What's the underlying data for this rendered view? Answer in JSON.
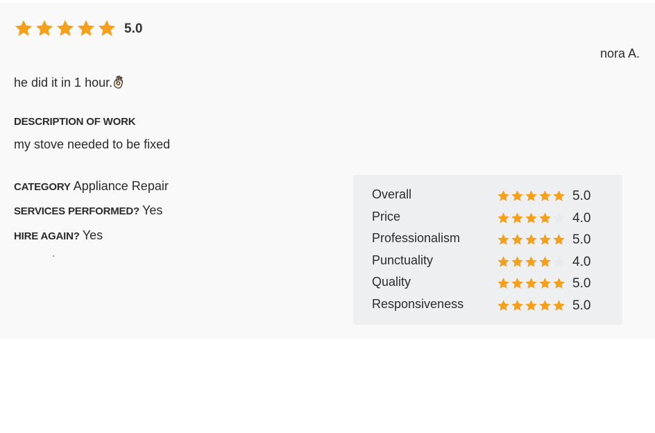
{
  "colors": {
    "star_filled": "#f5a01a",
    "star_empty": "#e8e9ec",
    "card_bg": "#f9f9fa",
    "ratings_bg": "#eeeff1"
  },
  "review": {
    "overall_stars": 5,
    "overall_score": "5.0",
    "reviewer": "nora A.",
    "text": "he did it in 1 hour.",
    "emoji_icon": "ok-hand-icon"
  },
  "description": {
    "label": "DESCRIPTION OF WORK",
    "text": "my stove needed to be fixed"
  },
  "details": [
    {
      "label": "CATEGORY",
      "value": "Appliance Repair"
    },
    {
      "label": "SERVICES PERFORMED?",
      "value": "Yes"
    },
    {
      "label": "HIRE AGAIN?",
      "value": "Yes"
    }
  ],
  "ratings": [
    {
      "label": "Overall",
      "stars": 5,
      "value": "5.0"
    },
    {
      "label": "Price",
      "stars": 4,
      "value": "4.0"
    },
    {
      "label": "Professionalism",
      "stars": 5,
      "value": "5.0"
    },
    {
      "label": "Punctuality",
      "stars": 4,
      "value": "4.0"
    },
    {
      "label": "Quality",
      "stars": 5,
      "value": "5.0"
    },
    {
      "label": "Responsiveness",
      "stars": 5,
      "value": "5.0"
    }
  ]
}
